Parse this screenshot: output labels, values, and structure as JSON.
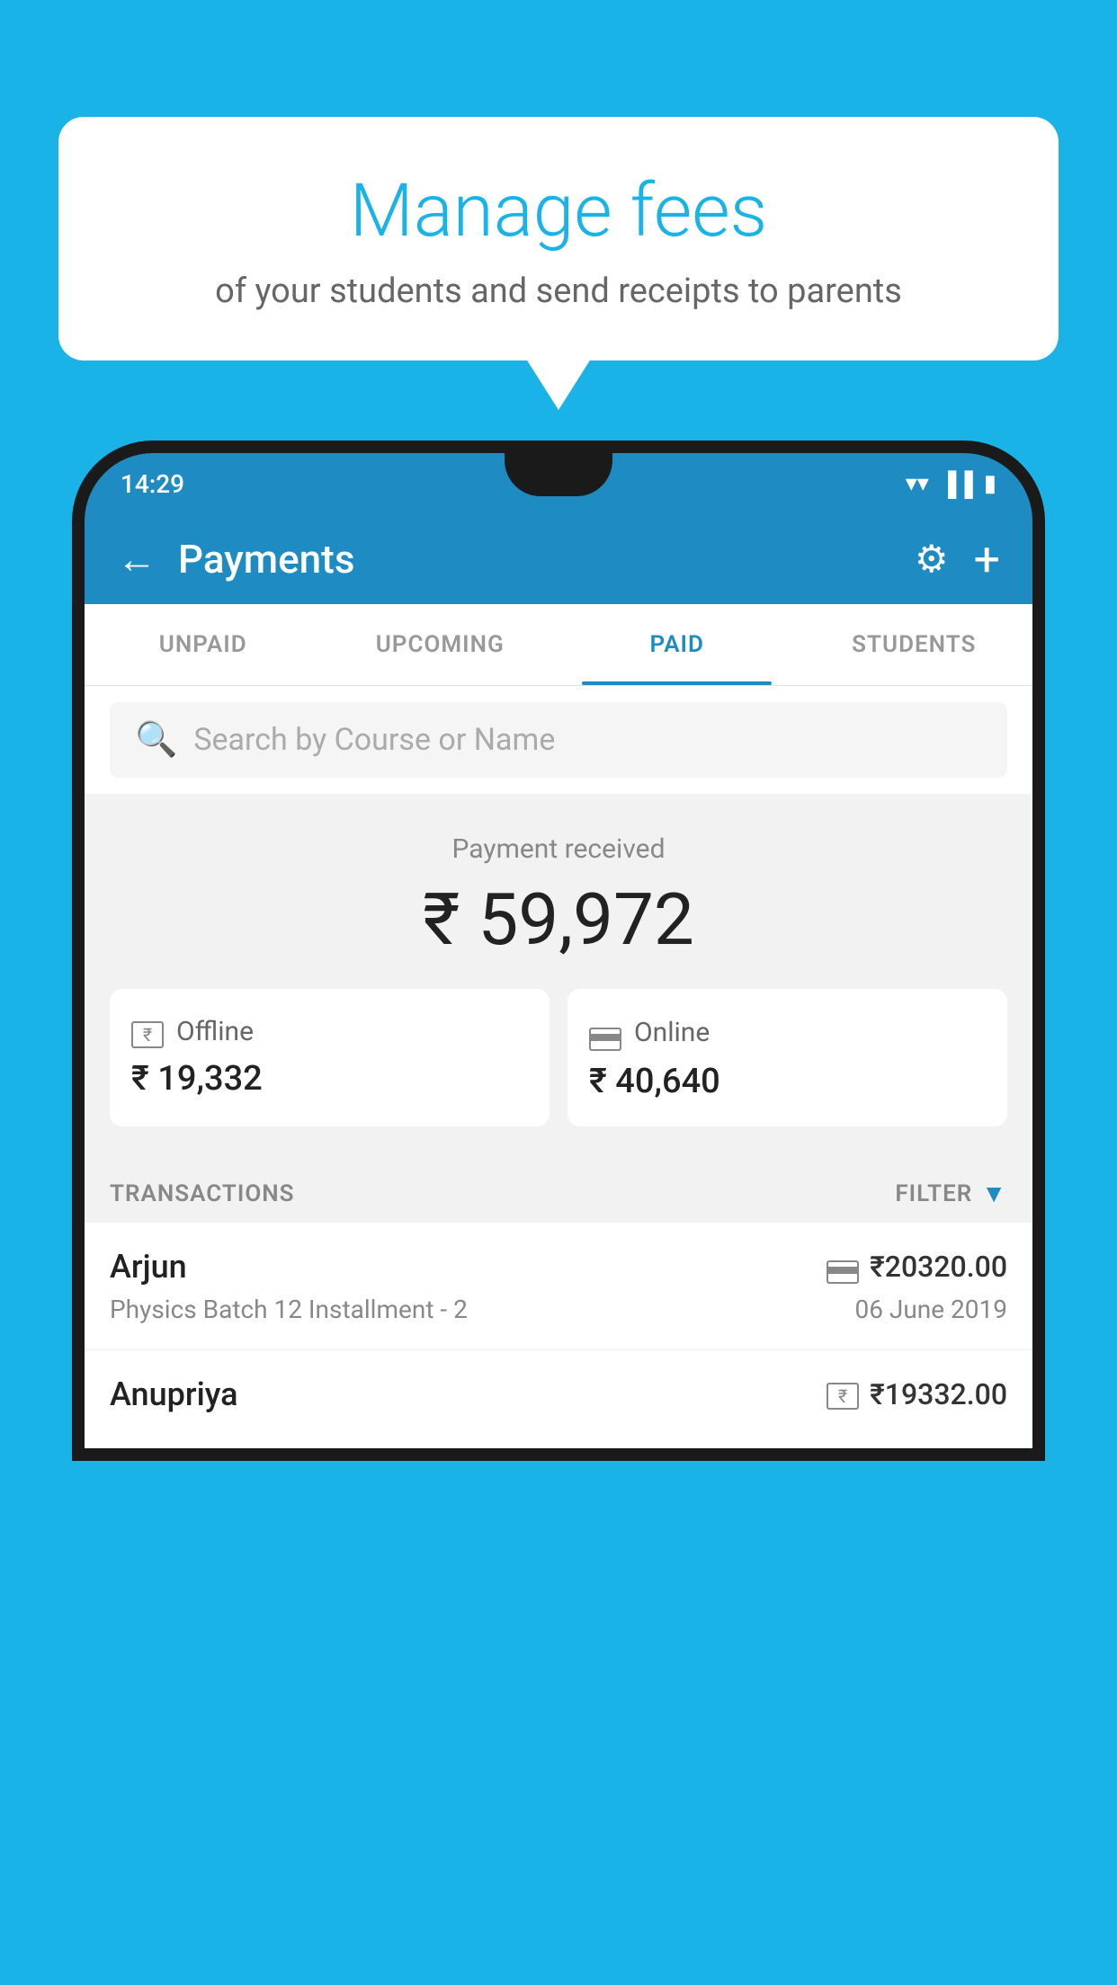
{
  "page": {
    "background_color": "#1ab3e8"
  },
  "speech_bubble": {
    "title": "Manage fees",
    "subtitle": "of your students and send receipts to parents"
  },
  "phone": {
    "status_bar": {
      "time": "14:29"
    },
    "header": {
      "title": "Payments",
      "back_label": "←",
      "settings_label": "⚙",
      "add_label": "+"
    },
    "tabs": [
      {
        "label": "UNPAID",
        "active": false
      },
      {
        "label": "UPCOMING",
        "active": false
      },
      {
        "label": "PAID",
        "active": true
      },
      {
        "label": "STUDENTS",
        "active": false
      }
    ],
    "search": {
      "placeholder": "Search by Course or Name"
    },
    "payment_summary": {
      "received_label": "Payment received",
      "total_amount": "₹ 59,972",
      "offline_label": "Offline",
      "offline_amount": "₹ 19,332",
      "online_label": "Online",
      "online_amount": "₹ 40,640"
    },
    "transactions": {
      "header_label": "TRANSACTIONS",
      "filter_label": "FILTER",
      "items": [
        {
          "name": "Arjun",
          "description": "Physics Batch 12 Installment - 2",
          "amount": "₹20320.00",
          "date": "06 June 2019",
          "payment_type": "online"
        },
        {
          "name": "Anupriya",
          "description": "",
          "amount": "₹19332.00",
          "date": "",
          "payment_type": "offline"
        }
      ]
    }
  }
}
